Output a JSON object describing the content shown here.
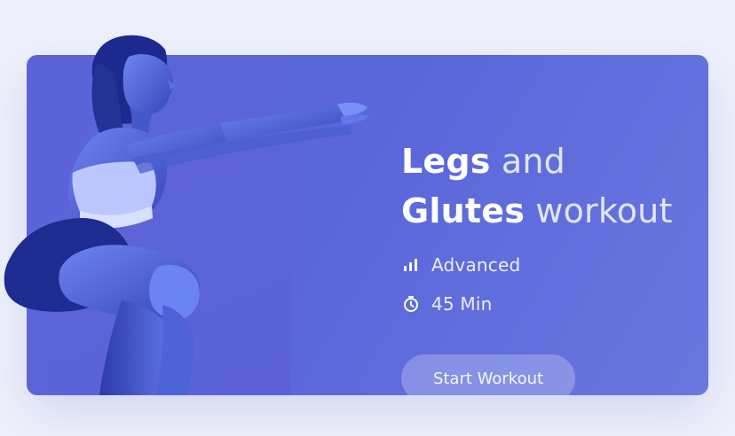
{
  "workout": {
    "title_part1": "Legs",
    "title_part2": " and",
    "title_part3": "Glutes",
    "title_part4": " workout",
    "level": "Advanced",
    "duration": "45 Min",
    "button_label": "Start Workout"
  },
  "colors": {
    "card_gradient_start": "#5c62d8",
    "card_gradient_end": "#6878df",
    "background": "#eef1fa"
  },
  "icons": {
    "level_icon": "bar-chart-icon",
    "duration_icon": "timer-icon"
  }
}
